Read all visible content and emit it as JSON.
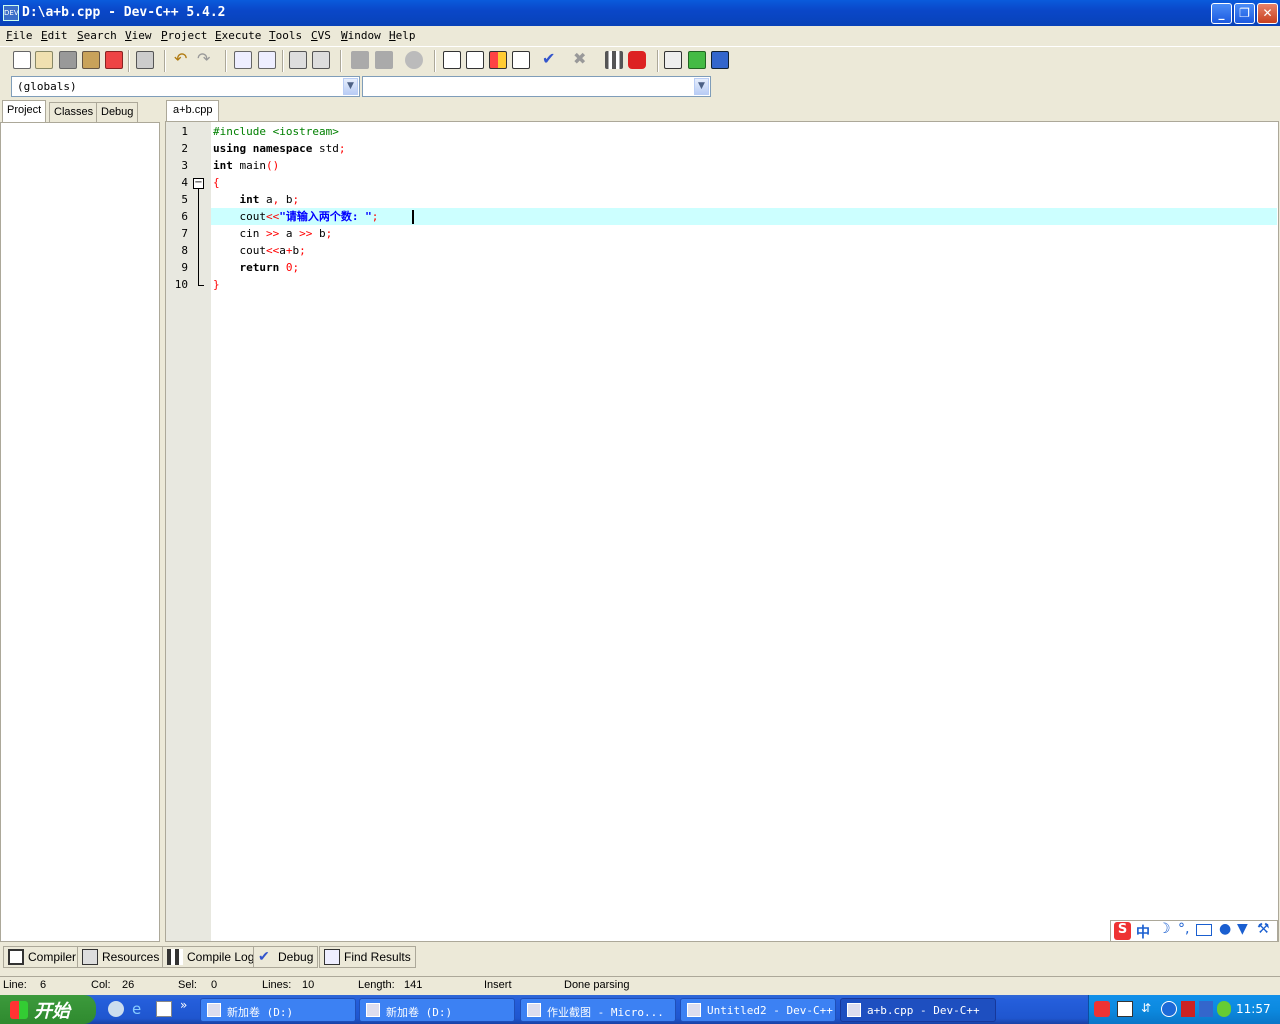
{
  "window": {
    "title": "D:\\a+b.cpp - Dev-C++ 5.4.2",
    "app_icon": "devcpp-icon",
    "controls": [
      "minimize-icon",
      "restore-icon",
      "close-icon"
    ]
  },
  "menu": [
    {
      "label": "File",
      "u": "F",
      "rest": "ile"
    },
    {
      "label": "Edit",
      "u": "E",
      "rest": "dit"
    },
    {
      "label": "Search",
      "u": "S",
      "rest": "earch"
    },
    {
      "label": "View",
      "u": "V",
      "rest": "iew"
    },
    {
      "label": "Project",
      "u": "P",
      "rest": "roject"
    },
    {
      "label": "Execute",
      "u": "E",
      "rest": "xecute"
    },
    {
      "label": "Tools",
      "u": "T",
      "rest": "ools"
    },
    {
      "label": "CVS",
      "u": "C",
      "rest": "VS"
    },
    {
      "label": "Window",
      "u": "W",
      "rest": "indow"
    },
    {
      "label": "Help",
      "u": "H",
      "rest": "elp"
    }
  ],
  "toolbar_icons": [
    "new-file-icon",
    "open-file-icon",
    "save-icon",
    "save-all-icon",
    "close-file-icon",
    "print-icon",
    "undo-icon",
    "redo-icon",
    "find-icon",
    "replace-icon",
    "indent-icon",
    "unindent-icon",
    "back-icon",
    "forward-icon",
    "goto-icon",
    "new-project-icon",
    "view-icon",
    "toggle-icon",
    "layout-icon",
    "check-icon",
    "stop-icon",
    "chart-icon",
    "debug-icon",
    "exit-icon",
    "import-icon",
    "book-icon"
  ],
  "scope_combo": {
    "value": "(globals)"
  },
  "member_combo": {
    "value": ""
  },
  "left_tabs": [
    "Project",
    "Classes",
    "Debug"
  ],
  "editor_tab": "a+b.cpp",
  "code": {
    "line_numbers": [
      "1",
      "2",
      "3",
      "4",
      "5",
      "6",
      "7",
      "8",
      "9",
      "10"
    ],
    "l1_pp": "#include <iostream>",
    "l2_kw1": "using",
    "l2_kw2": "namespace",
    "l2_id": "std",
    "l2_semi": ";",
    "l3_kw": "int",
    "l3_id": "main",
    "l3_paren": "()",
    "l4_brace": "{",
    "l5_kw": "int",
    "l5_a": "a",
    "l5_comma": ",",
    "l5_b": "b",
    "l5_semi": ";",
    "l6_id": "cout",
    "l6_op": "<<",
    "l6_str": "\"请输入两个数:",
    "l6_str_end": "\"",
    "l6_semi": ";",
    "l7_id": "cin",
    "l7_op1": ">>",
    "l7_a": "a",
    "l7_op2": ">>",
    "l7_b": "b",
    "l7_semi": ";",
    "l8_id": "cout",
    "l8_op": "<<",
    "l8_ab": "a",
    "l8_plus": "+",
    "l8_b": "b",
    "l8_semi": ";",
    "l9_kw": "return",
    "l9_num": "0",
    "l9_semi": ";",
    "l10_brace": "}"
  },
  "bottom_tabs": [
    {
      "label": "Compiler",
      "icon": "compiler-icon"
    },
    {
      "label": "Resources",
      "icon": "resources-icon"
    },
    {
      "label": "Compile Log",
      "icon": "compile-log-icon"
    },
    {
      "label": "Debug",
      "icon": "debug-check-icon"
    },
    {
      "label": "Find Results",
      "icon": "find-results-icon"
    }
  ],
  "status": {
    "line_label": "Line:",
    "line_value": "6",
    "col_label": "Col:",
    "col_value": "26",
    "sel_label": "Sel:",
    "sel_value": "0",
    "lines_label": "Lines:",
    "lines_value": "10",
    "length_label": "Length:",
    "length_value": "141",
    "mode": "Insert",
    "message": "Done parsing"
  },
  "ime": {
    "logo": "S",
    "mode": "中",
    "icons": [
      "moon-icon",
      "punct-icon",
      "keyboard-icon",
      "user-icon",
      "shirt-icon",
      "wrench-icon"
    ]
  },
  "taskbar": {
    "start_label": "开始",
    "chevron": "»",
    "buttons": [
      {
        "label": "新加卷 (D:)"
      },
      {
        "label": "新加卷 (D:)"
      },
      {
        "label": "作业截图 - Micro..."
      },
      {
        "label": "Untitled2 - Dev-C++"
      },
      {
        "label": "a+b.cpp - Dev-C++"
      }
    ],
    "clock": "11:57"
  }
}
